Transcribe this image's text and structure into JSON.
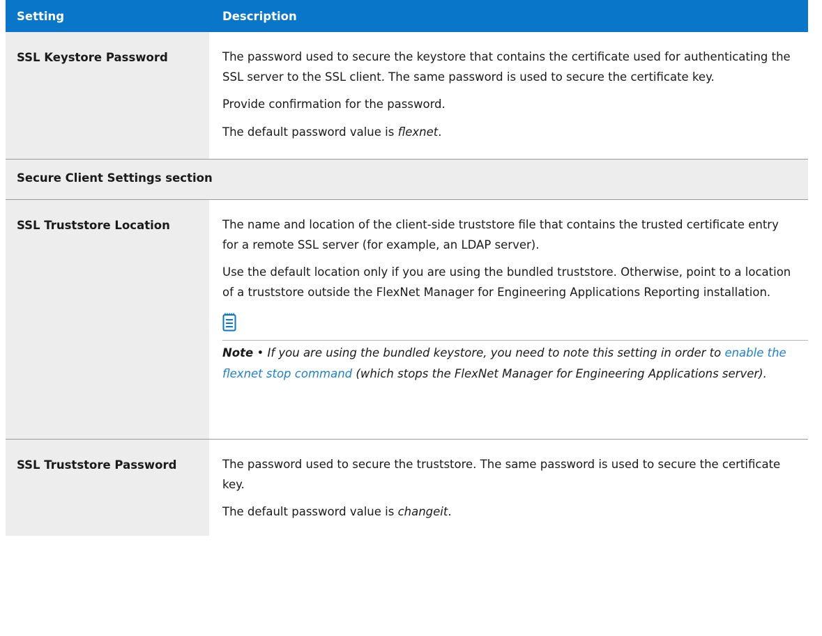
{
  "header": {
    "col_setting": "Setting",
    "col_description": "Description"
  },
  "rows": [
    {
      "setting": "SSL Keystore Password",
      "p1": "The password used to secure the keystore that contains the certificate used for authenticating the SSL server to the SSL client. The same password is used to secure the certificate key.",
      "p2": "Provide confirmation for the password.",
      "p3_prefix": "The default password value is ",
      "p3_value": "flexnet",
      "p3_suffix": "."
    },
    {
      "setting": "SSL Truststore Location",
      "p1": "The name and location of the client-side truststore file that contains the trusted certificate entry for a remote SSL server (for example, an LDAP server).",
      "p2": "Use the default location only if you are using the bundled truststore. Otherwise, point to a location of a truststore outside the FlexNet Manager for Engineering Applications Reporting installation.",
      "note": {
        "icon": "note-icon",
        "label": "Note",
        "bullet": " • ",
        "text_before": "If you are using the bundled keystore, you need to note this setting in order to ",
        "link": "enable the flexnet stop command",
        "text_after": " (which stops the FlexNet Manager for Engineering Applications server)."
      }
    },
    {
      "setting": "SSL Truststore Password",
      "p1": "The password used to secure the truststore. The same password is used to secure the certificate key.",
      "p2_prefix": "The default password value is ",
      "p2_value": "changeit",
      "p2_suffix": "."
    }
  ],
  "section": {
    "title": "Secure Client Settings section"
  },
  "colors": {
    "header_bg": "#0a76c9",
    "label_bg": "#ededed",
    "link": "#1e7fd0"
  }
}
